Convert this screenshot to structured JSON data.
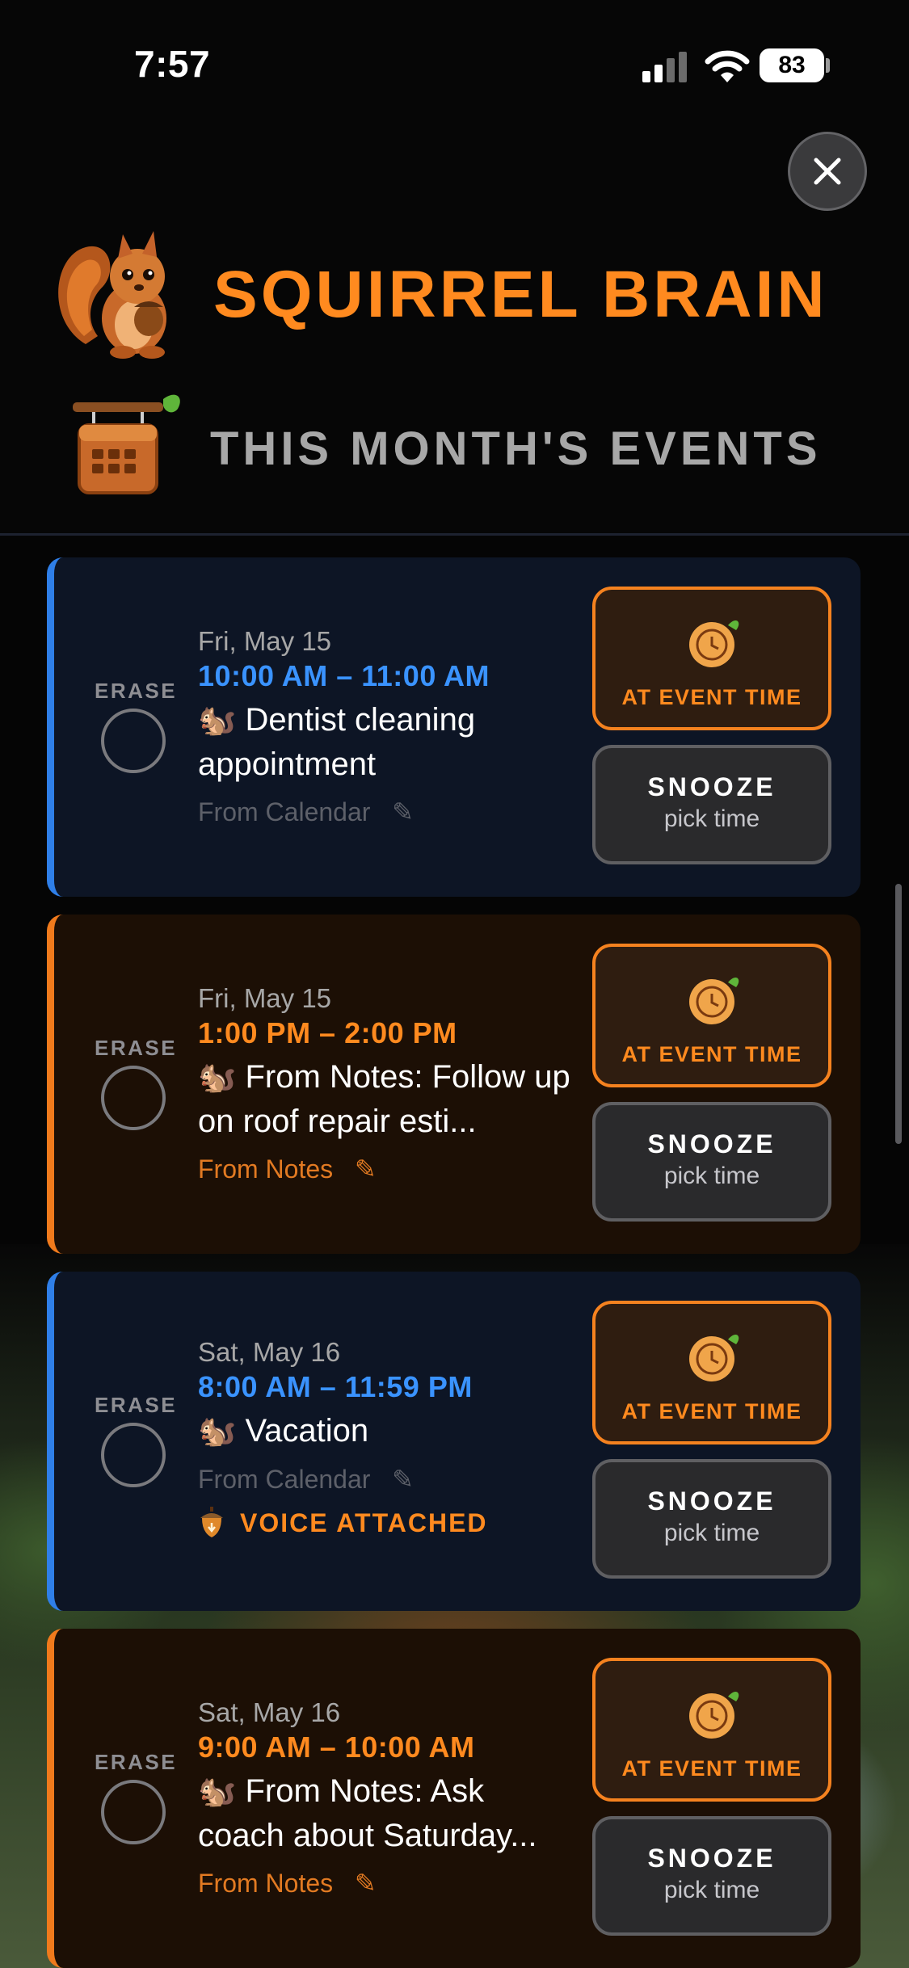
{
  "status_bar": {
    "time": "7:57",
    "battery": "83"
  },
  "header": {
    "app_title": "SQUIRREL BRAIN",
    "section_title": "THIS MONTH'S EVENTS"
  },
  "events": [
    {
      "erase_label": "ERASE",
      "date": "Fri, May 15",
      "time_range": "10:00 AM – 11:00 AM",
      "emoji": "🐿️",
      "title": "Dentist cleaning appointment",
      "source": "From Calendar",
      "source_edit_glyph": "✎",
      "voice_attached": "",
      "at_event_label": "AT EVENT TIME",
      "snooze_label": "SNOOZE",
      "snooze_sub": "pick time"
    },
    {
      "erase_label": "ERASE",
      "date": "Fri, May 15",
      "time_range": "1:00 PM – 2:00 PM",
      "emoji": "🐿️",
      "title": "From Notes: Follow up on roof repair esti...",
      "source": "From Notes",
      "source_edit_glyph": "✎",
      "voice_attached": "",
      "at_event_label": "AT EVENT TIME",
      "snooze_label": "SNOOZE",
      "snooze_sub": "pick time"
    },
    {
      "erase_label": "ERASE",
      "date": "Sat, May 16",
      "time_range": "8:00 AM – 11:59 PM",
      "emoji": "🐿️",
      "title": "Vacation",
      "source": "From Calendar",
      "source_edit_glyph": "✎",
      "voice_attached": "VOICE ATTACHED",
      "at_event_label": "AT EVENT TIME",
      "snooze_label": "SNOOZE",
      "snooze_sub": "pick time"
    },
    {
      "erase_label": "ERASE",
      "date": "Sat, May 16",
      "time_range": "9:00 AM – 10:00 AM",
      "emoji": "🐿️",
      "title": "From Notes: Ask coach about Saturday...",
      "source": "From Notes",
      "source_edit_glyph": "✎",
      "voice_attached": "",
      "at_event_label": "AT EVENT TIME",
      "snooze_label": "SNOOZE",
      "snooze_sub": "pick time"
    }
  ],
  "colors": {
    "accent_orange": "#ff8a1f",
    "calendar_blue": "#3a93ff",
    "card_blue_bg": "#0d1525",
    "card_orange_bg": "#1c0f05"
  },
  "icons": {
    "close": "close-icon",
    "logo": "squirrel-logo-icon",
    "calendar": "calendar-sign-icon",
    "alarm": "alarm-clock-icon",
    "acorn": "acorn-icon"
  }
}
